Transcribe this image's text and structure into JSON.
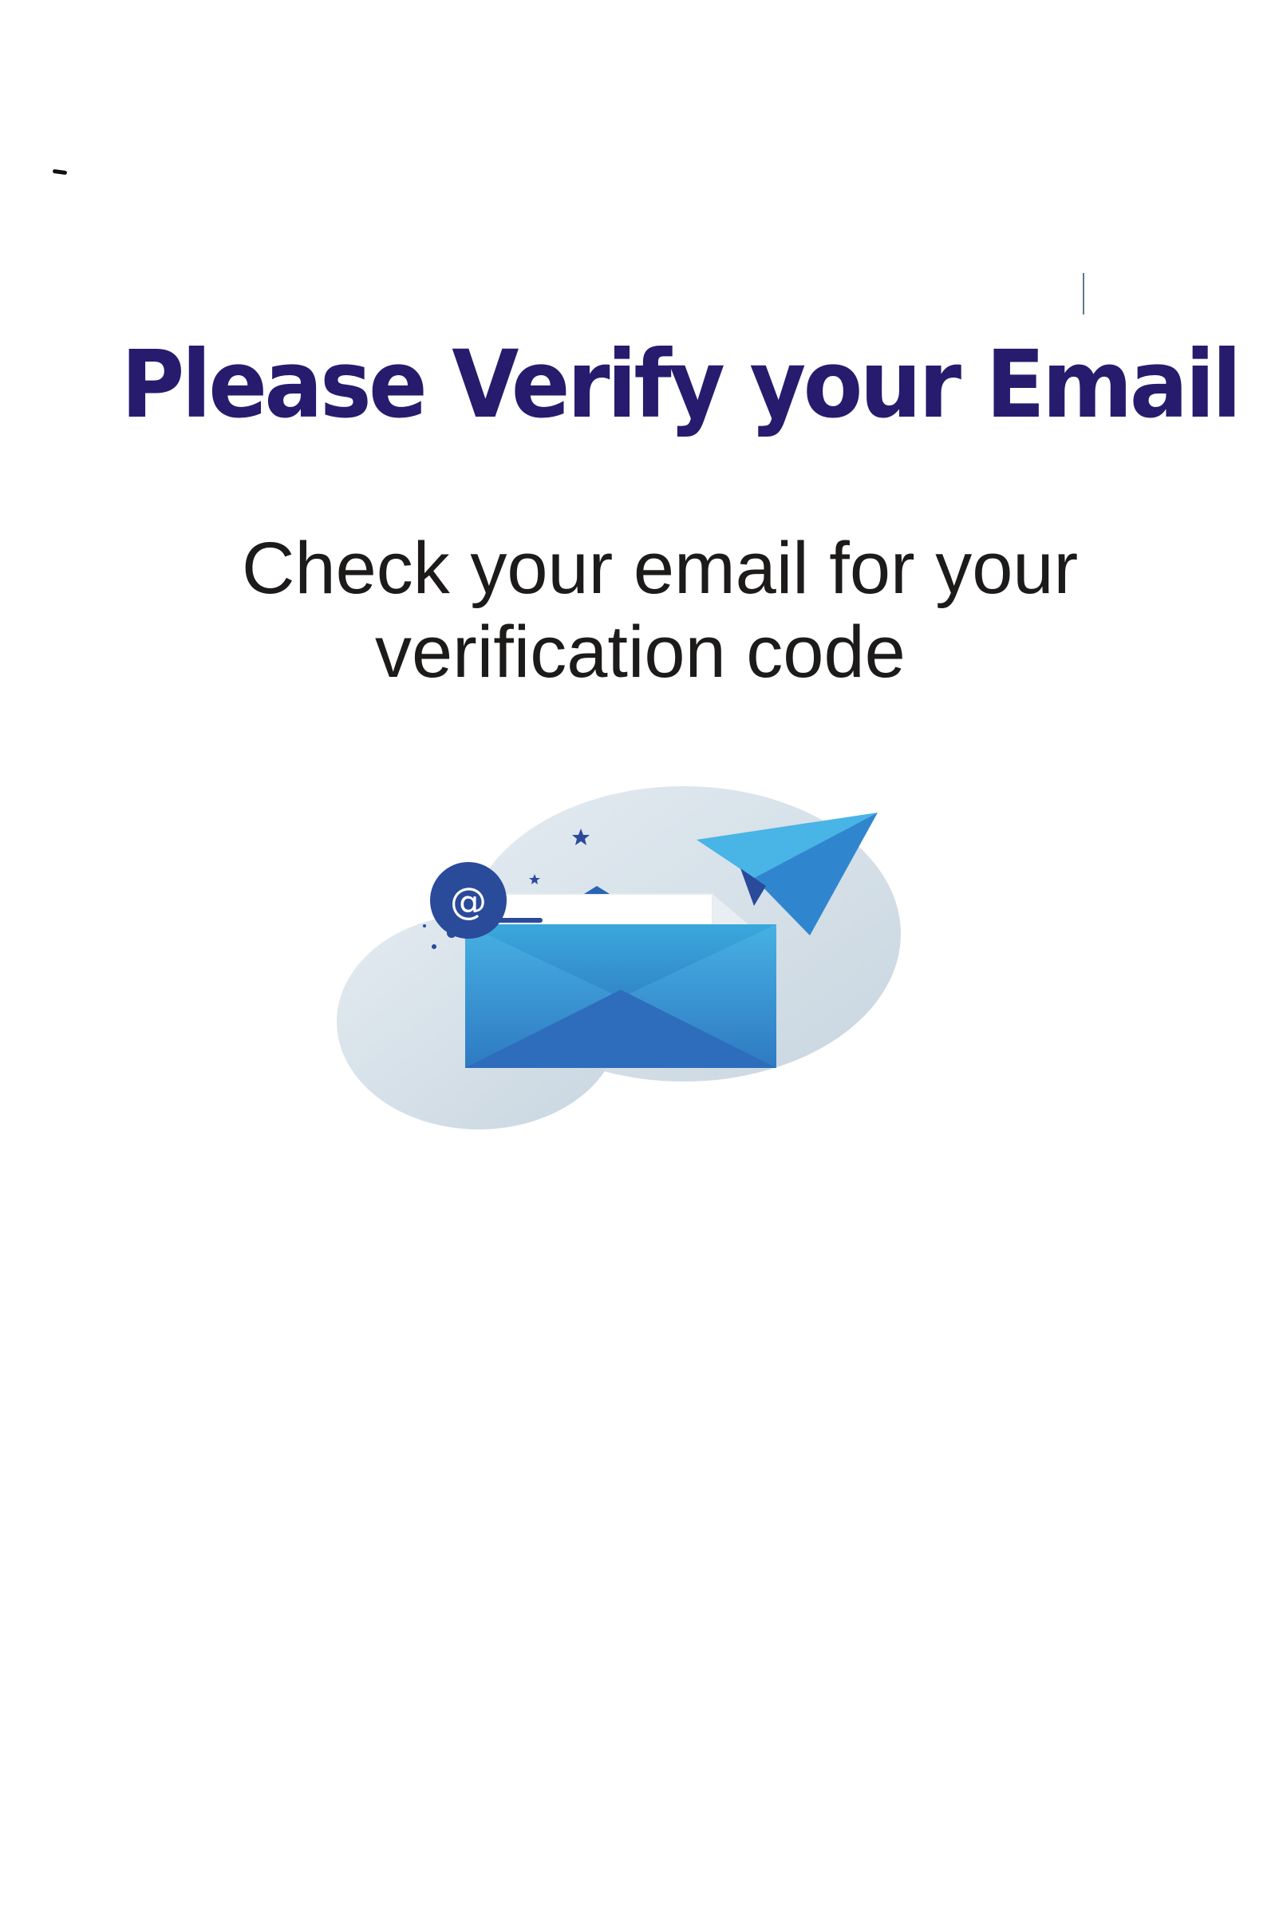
{
  "heading": {
    "title": "Please Verify your Email"
  },
  "message": {
    "line1": "Check your email for your",
    "line2": "verification code"
  },
  "illustration": {
    "icon": "email-envelope-paper-plane",
    "at_symbol": "@",
    "colors": {
      "blob": "#d3dde6",
      "envelope_top": "#3aa8dc",
      "envelope_bottom": "#2a64b4",
      "badge": "#2a4a9a",
      "plane_light": "#49b4e6",
      "plane_dark": "#2a4a9a"
    }
  }
}
